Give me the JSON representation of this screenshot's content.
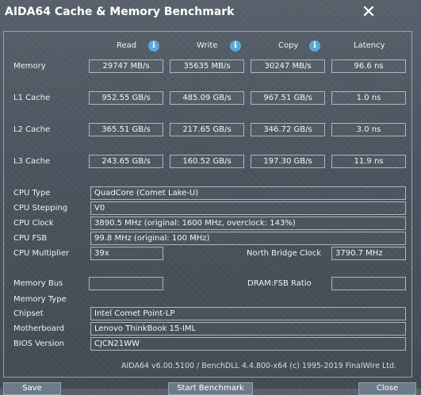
{
  "window": {
    "title": "AIDA64 Cache & Memory Benchmark",
    "close_glyph": "✕"
  },
  "columns": {
    "read": "Read",
    "write": "Write",
    "copy": "Copy",
    "latency": "Latency",
    "info_glyph": "i"
  },
  "bench": [
    {
      "label": "Memory",
      "read": "29747 MB/s",
      "write": "35635 MB/s",
      "copy": "30247 MB/s",
      "latency": "96.6 ns"
    },
    {
      "label": "L1 Cache",
      "read": "952.55 GB/s",
      "write": "485.09 GB/s",
      "copy": "967.51 GB/s",
      "latency": "1.0 ns"
    },
    {
      "label": "L2 Cache",
      "read": "365.51 GB/s",
      "write": "217.65 GB/s",
      "copy": "346.72 GB/s",
      "latency": "3.0 ns"
    },
    {
      "label": "L3 Cache",
      "read": "243.65 GB/s",
      "write": "160.52 GB/s",
      "copy": "197.30 GB/s",
      "latency": "11.9 ns"
    }
  ],
  "cpu": {
    "type_label": "CPU Type",
    "type_value": "QuadCore   (Comet Lake-U)",
    "stepping_label": "CPU Stepping",
    "stepping_value": "V0",
    "clock_label": "CPU Clock",
    "clock_value": "3890.5 MHz  (original: 1600 MHz, overclock: 143%)",
    "fsb_label": "CPU FSB",
    "fsb_value": "99.8 MHz  (original: 100 MHz)",
    "multiplier_label": "CPU Multiplier",
    "multiplier_value": "39x",
    "nb_clock_label": "North Bridge Clock",
    "nb_clock_value": "3790.7 MHz"
  },
  "system": {
    "membus_label": "Memory Bus",
    "membus_value": "",
    "dram_ratio_label": "DRAM:FSB Ratio",
    "dram_ratio_value": "",
    "memtype_label": "Memory Type",
    "memtype_value": "",
    "chipset_label": "Chipset",
    "chipset_value": "Intel Comet Point-LP",
    "motherboard_label": "Motherboard",
    "motherboard_value": "Lenovo ThinkBook 15-IML",
    "bios_label": "BIOS Version",
    "bios_value": "CJCN21WW"
  },
  "footer": {
    "text": "AIDA64 v6.00.5100 / BenchDLL 4.4.800-x64  (c) 1995-2019 FinalWire Ltd."
  },
  "buttons": {
    "left": "Save",
    "middle": "Start Benchmark",
    "right": "Close"
  }
}
